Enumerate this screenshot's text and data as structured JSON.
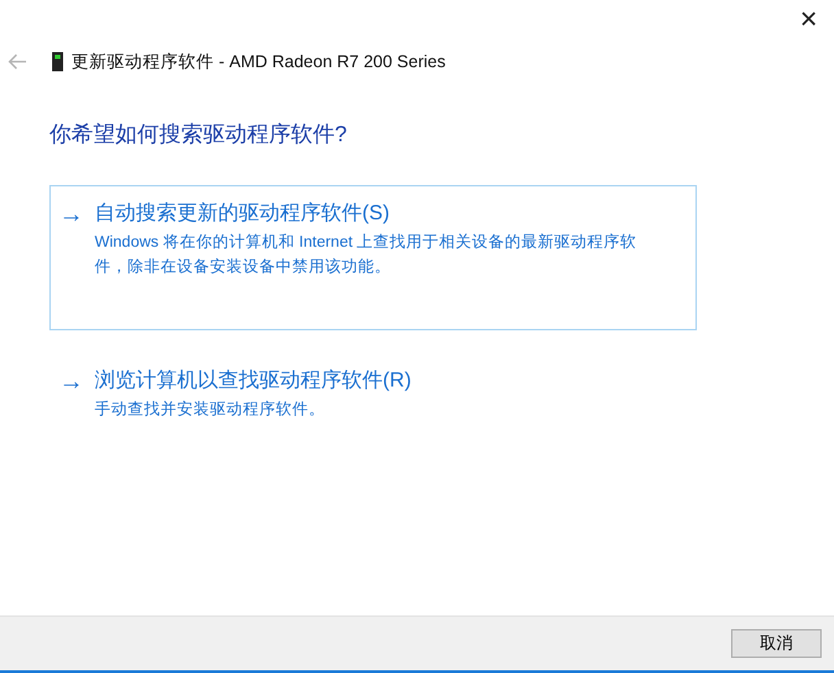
{
  "window": {
    "title": "更新驱动程序软件 - AMD Radeon R7 200 Series",
    "close": "×"
  },
  "heading": "你希望如何搜索驱动程序软件?",
  "options": [
    {
      "arrow": "→",
      "title": "自动搜索更新的驱动程序软件(S)",
      "description": "Windows 将在你的计算机和 Internet 上查找用于相关设备的最新驱动程序软件，除非在设备安装设备中禁用该功能。",
      "selected": true
    },
    {
      "arrow": "→",
      "title": "浏览计算机以查找驱动程序软件(R)",
      "description": "手动查找并安装驱动程序软件。",
      "selected": false
    }
  ],
  "buttons": [
    "取消"
  ]
}
